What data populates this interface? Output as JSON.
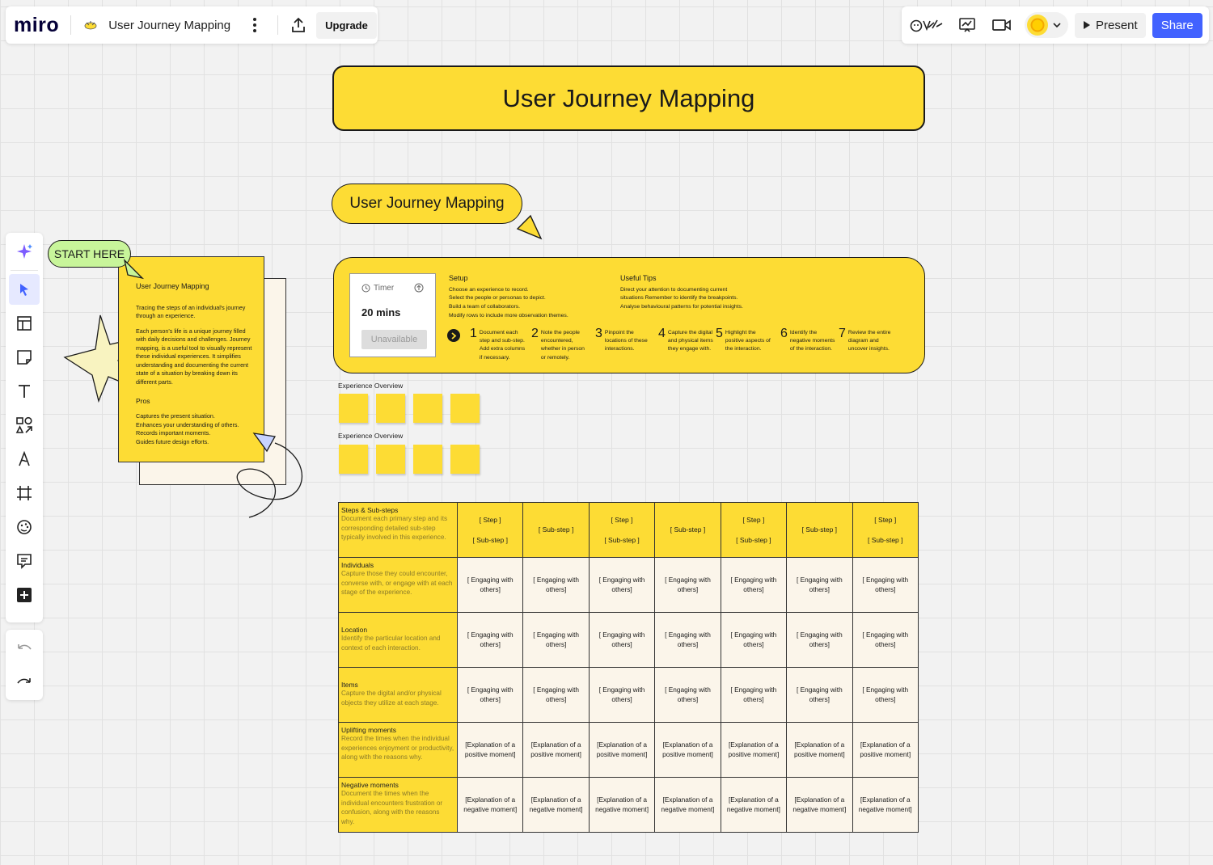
{
  "app": {
    "logo": "miro",
    "board_title": "User Journey Mapping",
    "upgrade_label": "Upgrade",
    "present_label": "Present",
    "share_label": "Share",
    "accent_color": "#4262ff",
    "sticky_color": "#fddc34"
  },
  "toolbar": {
    "items": [
      "ai-assist-icon",
      "select-icon",
      "templates-icon",
      "sticky-note-icon",
      "text-icon",
      "shapes-icon",
      "pen-icon",
      "frame-icon",
      "reactions-icon",
      "comment-icon",
      "add-more-icon"
    ],
    "history": [
      "undo-icon",
      "redo-icon"
    ]
  },
  "board": {
    "main_title": "User Journey Mapping",
    "pill_title": "User Journey Mapping",
    "start_here": "START HERE",
    "intro_doc": {
      "title": "User Journey Mapping",
      "para1": "Tracing the steps of an individual's journey through an experience.",
      "para2": "Each person's life is a unique journey filled with daily decisions and challenges. Journey mapping, is a useful tool to visually represent these individual experiences. It simplifies understanding and documenting the current state of a situation by breaking down its different parts.",
      "pros_title": "Pros",
      "pros": [
        "Captures the present situation.",
        "Enhances your understanding of others.",
        "Records important moments.",
        "Guides future design efforts."
      ]
    },
    "timer": {
      "label": "Timer",
      "value": "20 mins",
      "button": "Unavailable"
    },
    "setup": {
      "title": "Setup",
      "lines": [
        "Choose an experience to record.",
        "Select the people or personas to depict.",
        "Build a team of collaborators.",
        "Modify rows to include more observation themes."
      ]
    },
    "tips": {
      "title": "Useful Tips",
      "lines": [
        "Direct your attention to documenting current",
        "situations Remember to identify the breakpoints.",
        "Analyse behavioural patterns for potential insights."
      ]
    },
    "steps": [
      {
        "num": "1",
        "text": "Document each step and sub-step. Add extra columns if necessary."
      },
      {
        "num": "2",
        "text": "Note the people encountered, whether in person or remotely."
      },
      {
        "num": "3",
        "text": "Pinpoint the locations of these interactions."
      },
      {
        "num": "4",
        "text": "Capture the digital and physical items they engage with."
      },
      {
        "num": "5",
        "text": "Highlight the positive aspects of the interaction."
      },
      {
        "num": "6",
        "text": "Identify the negative moments of the interaction."
      },
      {
        "num": "7",
        "text": "Review the entire diagram and uncover insights."
      }
    ],
    "experience_overview_1": "Experience Overview",
    "experience_overview_2": "Experience Overview"
  },
  "table": {
    "rows": [
      {
        "title": "Steps & Sub-steps",
        "desc": "Document each primary step and its corresponding detailed sub-step typically involved in this experience."
      },
      {
        "title": "Individuals",
        "desc": "Capture those they could encounter, converse with, or engage with at each stage of the experience."
      },
      {
        "title": "Location",
        "desc": "Identify the particular location and context of each interaction."
      },
      {
        "title": "Items",
        "desc": "Capture the digital and/or physical objects they utilize at each stage."
      },
      {
        "title": "Uplifting moments",
        "desc": "Record the times when the individual experiences enjoyment or productivity, along with the reasons why."
      },
      {
        "title": "Negative moments",
        "desc": "Document the times when the individual encounters frustration or confusion, along with the reasons why."
      }
    ],
    "step_label": "[ Step ]",
    "substep_label": "[ Sub-step ]",
    "engaging_cell": "[ Engaging with others]",
    "positive_cell": "[Explanation of a positive moment]",
    "negative_cell": "[Explanation of a negative moment]"
  }
}
